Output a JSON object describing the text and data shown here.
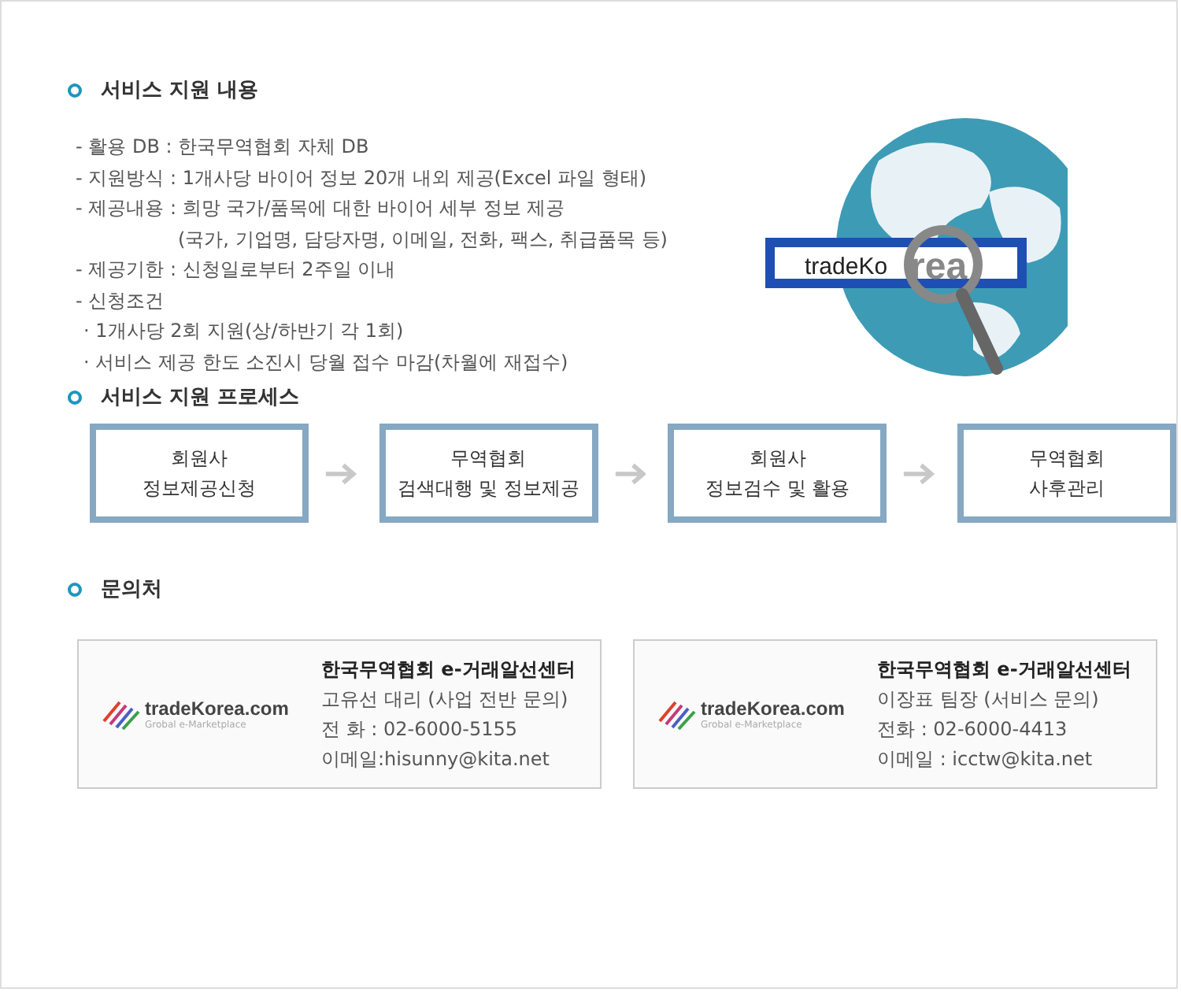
{
  "service": {
    "title": "서비스 지원 내용",
    "lines": [
      {
        "kind": "dash",
        "text": "- 활용 DB : 한국무역협회 자체 DB"
      },
      {
        "kind": "dash",
        "text": "- 지원방식 : 1개사당 바이어 정보 20개 내외 제공(Excel 파일 형태)"
      },
      {
        "kind": "dash",
        "text": "- 제공내용 : 희망 국가/품목에 대한 바이어 세부 정보 제공"
      },
      {
        "kind": "cont",
        "text": "(국가, 기업명, 담당자명, 이메일, 전화, 팩스, 취급품목 등)"
      },
      {
        "kind": "dash",
        "text": "- 제공기한 : 신청일로부터 2주일 이내"
      },
      {
        "kind": "dash",
        "text": "- 신청조건"
      },
      {
        "kind": "dot",
        "text": "· 1개사당 2회 지원(상/하반기 각 1회)"
      },
      {
        "kind": "dot",
        "text": "· 서비스 제공 한도 소진시 당월 접수 마감(차월에 재접수)"
      }
    ],
    "illustration": {
      "dark_text": "tradeKo",
      "light_text": "rea"
    }
  },
  "process": {
    "title": "서비스 지원 프로세스",
    "steps": [
      {
        "lines": [
          "회원사",
          "정보제공신청"
        ]
      },
      {
        "lines": [
          "무역협회",
          "검색대행 및 정보제공"
        ]
      },
      {
        "lines": [
          "회원사",
          "정보검수 및 활용"
        ]
      },
      {
        "lines": [
          "무역협회",
          "사후관리"
        ]
      }
    ]
  },
  "contact": {
    "title": "문의처",
    "cards": [
      {
        "logo": "tradeKorea.com",
        "tagline": "Grobal e-Marketplace",
        "org": "한국무역협회 e-거래알선센터",
        "person": "고유선 대리 (사업 전반 문의)",
        "phone": "전 화 : 02-6000-5155",
        "email": "이메일:hisunny@kita.net"
      },
      {
        "logo": "tradeKorea.com",
        "tagline": "Grobal e-Marketplace",
        "org": "한국무역협회 e-거래알선센터",
        "person": "이장표 팀장 (서비스 문의)",
        "phone": "전화 : 02-6000-4413",
        "email": "이메일 : icctw@kita.net"
      }
    ]
  }
}
